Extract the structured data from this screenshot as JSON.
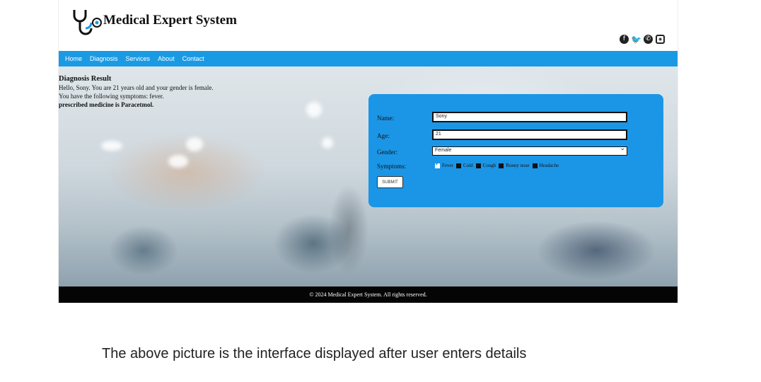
{
  "site": {
    "title": "Medical Expert System"
  },
  "nav": {
    "items": [
      "Home",
      "Diagnosis",
      "Services",
      "About",
      "Contact"
    ]
  },
  "social": {
    "icons": [
      "facebook-icon",
      "twitter-icon",
      "whatsapp-icon",
      "instagram-icon"
    ]
  },
  "result": {
    "heading": "Diagnosis Result",
    "line1": "Hello, Sony. You are 21 years old and your gender is female.",
    "line2": "You have the following symptoms: fever.",
    "line3": "prescribed medicine is Paracetmol."
  },
  "form": {
    "name_label": "Name:",
    "name_value": "Sony",
    "age_label": "Age:",
    "age_value": "21",
    "gender_label": "Gender:",
    "gender_value": "Female",
    "symptoms_label": "Symptoms:",
    "symptoms": [
      {
        "label": "Fever",
        "checked": true
      },
      {
        "label": "Cold",
        "checked": false
      },
      {
        "label": "Cough",
        "checked": false
      },
      {
        "label": "Runny nose",
        "checked": false
      },
      {
        "label": "Headache",
        "checked": false
      }
    ],
    "submit_label": "SUBMIT"
  },
  "footer": {
    "text": "© 2024 Medical Expert System. All rights reserved."
  },
  "caption": "The above picture is the interface displayed after user enters details",
  "colors": {
    "nav": "#1b9ae4",
    "panel": "#1b96e6",
    "footer": "#050505"
  }
}
